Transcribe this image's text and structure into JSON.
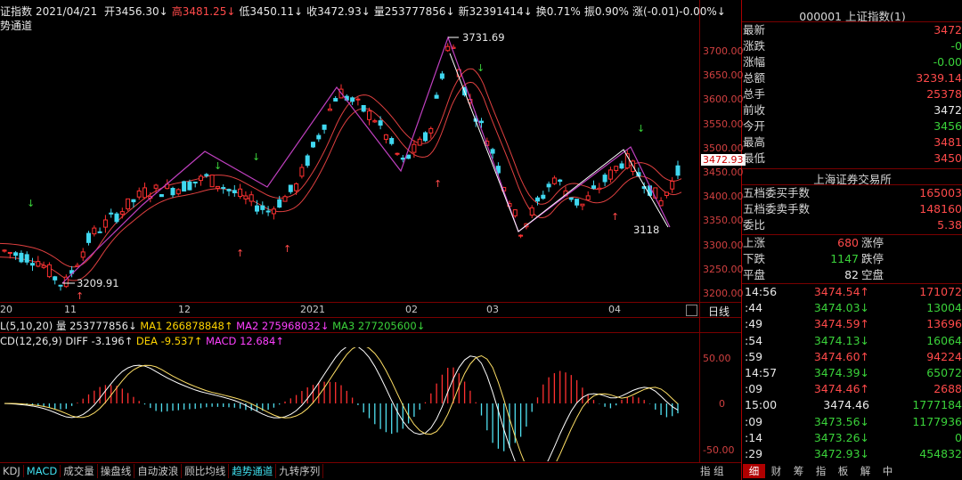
{
  "header": {
    "index_name_partial": "证指数",
    "date": "2021/04/21",
    "open": "开3456.30↓",
    "high": "高3481.25↓",
    "low": "低3450.11↓",
    "close": "收3472.93↓",
    "volume": "量253777856↓",
    "new": "新32391414↓",
    "turnover": "换0.71%",
    "amplitude": "振0.90%",
    "change": "涨(-0.01)-0.00%↓",
    "sub_label": "势通道"
  },
  "main_chart": {
    "y_ticks": [
      "3700.00",
      "3650.00",
      "3600.00",
      "3550.00",
      "3500.00",
      "3450.00",
      "3400.00",
      "3350.00",
      "3300.00",
      "3250.00",
      "3200.00"
    ],
    "x_ticks": [
      "20",
      "11",
      "12",
      "2021",
      "02",
      "03",
      "04"
    ],
    "annotations": {
      "peak": "3731.69",
      "low": "3209.91",
      "trough": "3118"
    },
    "current_price_tag": "3472.93",
    "period_label": "日线"
  },
  "volume_line": {
    "label": "L(5,10,20)",
    "vol": "量 253777856↓",
    "ma1": "MA1 266878848↑",
    "ma2": "MA2 275968032↓",
    "ma3": "MA3 277205600↓"
  },
  "macd": {
    "label": "CD(12,26,9)",
    "diff": "DIFF -3.196↑",
    "dea": "DEA -9.537↑",
    "macd": "MACD 12.684↑",
    "y_ticks": [
      "50.00",
      "0",
      "-50.00"
    ]
  },
  "bottom_tabs": [
    "KDJ",
    "MACD",
    "成交量",
    "操盘线",
    "自动波浪",
    "顾比均线",
    "趋势通道",
    "九转序列"
  ],
  "bottom_right": {
    "zhi": "指",
    "zu": "组"
  },
  "right_tabs": [
    "细",
    "财",
    "筹",
    "指",
    "板",
    "解",
    "中"
  ],
  "quote_panel": {
    "title": "000001 上证指数(1)",
    "rows": [
      {
        "label": "最新",
        "value": "3472"
      },
      {
        "label": "涨跌",
        "value": "-0"
      },
      {
        "label": "涨幅",
        "value": "-0.00"
      },
      {
        "label": "总额",
        "value": "3239.14"
      },
      {
        "label": "总手",
        "value": "25378"
      },
      {
        "label": "前收",
        "value": "3472"
      },
      {
        "label": "今开",
        "value": "3456"
      },
      {
        "label": "最高",
        "value": "3481"
      },
      {
        "label": "最低",
        "value": "3450"
      }
    ],
    "exchange": "上海证券交易所",
    "order_rows": [
      {
        "label": "五档委买手数",
        "value": "165003"
      },
      {
        "label": "五档委卖手数",
        "value": "148160"
      },
      {
        "label": "委比",
        "value": "5.38"
      }
    ],
    "breadth": [
      {
        "label": "上涨",
        "num": "680",
        "tag": "涨停"
      },
      {
        "label": "下跌",
        "num": "1147",
        "tag": "跌停"
      },
      {
        "label": "平盘",
        "num": "82",
        "tag": "空盘"
      }
    ],
    "ticks": [
      {
        "time": "14:56",
        "price": "3474.54↑",
        "vol": "171072"
      },
      {
        "time": ":44",
        "price": "3474.03↓",
        "vol": "13004"
      },
      {
        "time": ":49",
        "price": "3474.59↑",
        "vol": "13696"
      },
      {
        "time": ":54",
        "price": "3474.13↓",
        "vol": "16064"
      },
      {
        "time": ":59",
        "price": "3474.60↑",
        "vol": "94224"
      },
      {
        "time": "14:57",
        "price": "3474.39↓",
        "vol": "65072"
      },
      {
        "time": ":09",
        "price": "3474.46↑",
        "vol": "2688"
      },
      {
        "time": "15:00",
        "price": "3474.46",
        "vol": "1777184"
      },
      {
        "time": ":09",
        "price": "3473.56↓",
        "vol": "1177936"
      },
      {
        "time": ":14",
        "price": "3473.26↓",
        "vol": "0"
      },
      {
        "time": ":29",
        "price": "3472.93↓",
        "vol": "454832"
      }
    ]
  }
}
